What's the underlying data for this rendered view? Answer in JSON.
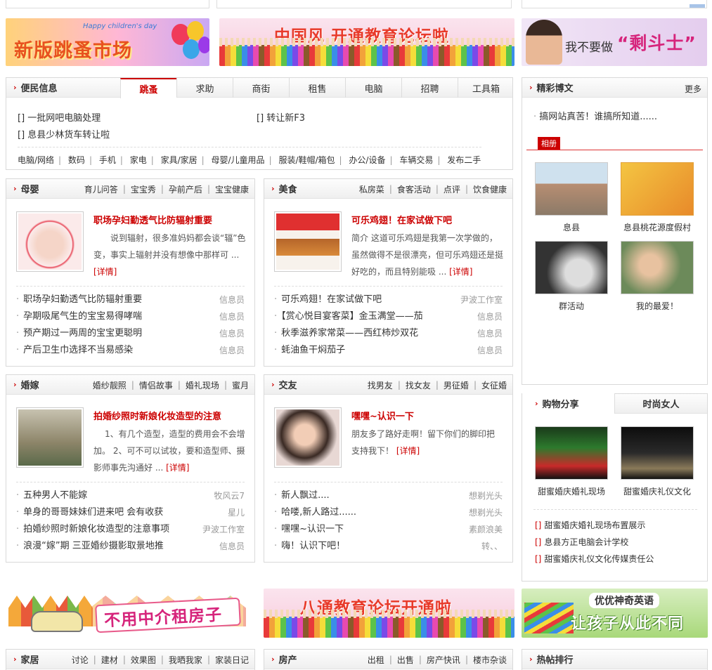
{
  "banners": {
    "fleamarket": {
      "small": "Happy children's day",
      "text": "新版跳蚤市场"
    },
    "forum_top": "中国风 开通教育论坛啦",
    "fighter": {
      "pre": "我不要做",
      "quote": "“剩斗士”"
    },
    "rent": "不用中介租房子",
    "forum_bottom": "八通教育论坛开通啦",
    "english": {
      "line1": "优优神奇英语",
      "line2": "让孩子从此不同"
    }
  },
  "minsheng": {
    "title": "便民信息",
    "tabs": [
      "跳蚤",
      "求助",
      "商街",
      "租售",
      "电脑",
      "招聘",
      "工具箱"
    ],
    "items": [
      "[] 一批网吧电脑处理",
      "[] 转让新F3",
      "[] 息县少林货车转让啦"
    ],
    "categories": [
      "电脑/网络",
      "数码",
      "手机",
      "家电",
      "家具/家居",
      "母婴/儿童用品",
      "服装/鞋帽/箱包",
      "办公/设备",
      "车辆交易",
      "发布二手"
    ]
  },
  "blog": {
    "title": "精彩博文",
    "more": "更多",
    "post": "搞网站真苦！谁搞所知道......",
    "album_tag": "相册",
    "photos": [
      "息县",
      "息县桃花源度假村",
      "群活动",
      "我的最爱！"
    ]
  },
  "muying": {
    "title": "母婴",
    "subnav": [
      "育儿问答",
      "宝宝秀",
      "孕前产后",
      "宝宝健康"
    ],
    "feat_title": "职场孕妇勤透气比防辐射重要",
    "feat_desc": "说到辐射，很多准妈妈都会谈“辐”色变，事实上辐射并没有想像中那样可 ...",
    "detail": "[详情]",
    "list": [
      {
        "t": "职场孕妇勤透气比防辐射重要",
        "a": "信息员"
      },
      {
        "t": "孕期吸尾气生的宝宝易得哮喘",
        "a": "信息员"
      },
      {
        "t": "预产期过一两周的宝宝更聪明",
        "a": "信息员"
      },
      {
        "t": "产后卫生巾选择不当易感染",
        "a": "信息员"
      }
    ]
  },
  "meishi": {
    "title": "美食",
    "subnav": [
      "私房菜",
      "食客活动",
      "点评",
      "饮食健康"
    ],
    "feat_title": "可乐鸡翅！在家试做下吧",
    "feat_desc": "简介 这道可乐鸡翅是我第一次学做的，虽然做得不是很漂亮，但可乐鸡翅还是挺好吃的，而且特别能吸 ...",
    "detail": "[详情]",
    "list": [
      {
        "t": "可乐鸡翅！在家试做下吧",
        "a": "尹波工作室"
      },
      {
        "t": "【赏心悦目宴客菜】金玉满堂——茄",
        "a": "信息员"
      },
      {
        "t": "秋季滋养家常菜——西红柿炒双花",
        "a": "信息员"
      },
      {
        "t": "蚝油鱼干焖茄子",
        "a": "信息员"
      }
    ]
  },
  "hunjia": {
    "title": "婚嫁",
    "subnav": [
      "婚纱靓照",
      "情侣故事",
      "婚礼现场",
      "蜜月"
    ],
    "feat_title": "拍婚纱照时新娘化妆造型的注意",
    "feat_desc": "1、有几个造型，造型的费用会不会增加。 2、可不可以试妆，要和造型师、摄影师事先沟通好 ...",
    "detail": "[详情]",
    "list": [
      {
        "t": "五种男人不能嫁",
        "a": "牧风云7"
      },
      {
        "t": "单身的哥哥妹妹们进来吧 会有收获",
        "a": "星儿"
      },
      {
        "t": "拍婚纱照时新娘化妆造型的注意事项",
        "a": "尹波工作室"
      },
      {
        "t": "浪漫“嫁”期 三亚婚纱摄影取景地推",
        "a": "信息员"
      }
    ]
  },
  "jiaoyou": {
    "title": "交友",
    "subnav": [
      "找男友",
      "找女友",
      "男征婚",
      "女征婚"
    ],
    "feat_title": "嘿嘿~认识一下",
    "feat_desc": "朋友多了路好走啊！留下你们的脚印把支持我下！",
    "detail": "[详情]",
    "list": [
      {
        "t": "新人飘过....",
        "a": "想剃光头"
      },
      {
        "t": "哈喽,新人路过......",
        "a": "想剃光头"
      },
      {
        "t": "嘿嘿~认识一下",
        "a": "素颜浪美"
      },
      {
        "t": "嗨！认识下吧！",
        "a": "转、、"
      }
    ]
  },
  "shopping": {
    "tab1": "购物分享",
    "tab2": "时尚女人",
    "thumbs": [
      "甜蜜婚庆婚礼现场",
      "甜蜜婚庆礼仪文化"
    ],
    "list": [
      "甜蜜婚庆婚礼现场布置展示",
      "息县方正电脑会计学校",
      "甜蜜婚庆礼仪文化传媒责任公"
    ]
  },
  "jiaju": {
    "title": "家居",
    "subnav": [
      "讨论",
      "建材",
      "效果图",
      "我晒我家",
      "家装日记"
    ]
  },
  "fangchan": {
    "title": "房产",
    "subnav": [
      "出租",
      "出售",
      "房产快讯",
      "楼市杂谈"
    ]
  },
  "hot": {
    "title": "热帖排行"
  }
}
